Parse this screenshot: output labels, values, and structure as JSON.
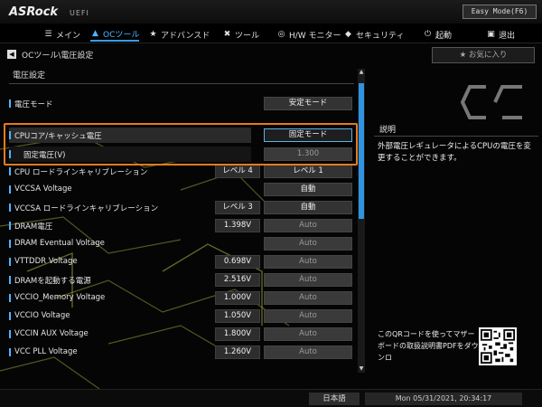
{
  "header": {
    "logo": "ASRock",
    "logo_sub": "UEFI",
    "easy_mode": "Easy Mode(F6)"
  },
  "nav": {
    "items": [
      {
        "label": "メイン",
        "icon": "menu-icon"
      },
      {
        "label": "OCツール",
        "icon": "rocket-icon"
      },
      {
        "label": "アドバンスド",
        "icon": "star-icon"
      },
      {
        "label": "ツール",
        "icon": "tools-icon"
      },
      {
        "label": "H/W モニター",
        "icon": "monitor-icon"
      },
      {
        "label": "セキュリティ",
        "icon": "shield-icon"
      },
      {
        "label": "起動",
        "icon": "power-icon"
      },
      {
        "label": "退出",
        "icon": "exit-icon"
      }
    ],
    "active": "OCツール"
  },
  "breadcrumb": "OCツール\\電圧設定",
  "favorite_label": "お気に入り",
  "section_title": "電圧設定",
  "rows": [
    {
      "label": "電圧モード",
      "value": "安定モード",
      "dim": false
    },
    {
      "label": "CPUコア/キャッシュ電圧",
      "value": "固定モード",
      "dim": false,
      "highlight": true
    },
    {
      "label": "固定電圧(V)",
      "value": "1.300",
      "dim": true,
      "subrow": true
    },
    {
      "label": "CPU ロードラインキャリブレーション",
      "sub": "レベル 4",
      "value": "レベル 1",
      "dim": false
    },
    {
      "label": "VCCSA Voltage",
      "value": "自動",
      "dim": false
    },
    {
      "label": "VCCSA ロードラインキャリブレーション",
      "sub": "レベル 3",
      "value": "自動",
      "dim": false
    },
    {
      "label": "DRAM電圧",
      "sub": "1.398V",
      "value": "Auto",
      "dim": true
    },
    {
      "label": "DRAM Eventual Voltage",
      "value": "Auto",
      "dim": true
    },
    {
      "label": "VTTDDR Voltage",
      "sub": "0.698V",
      "value": "Auto",
      "dim": true
    },
    {
      "label": "DRAMを起動する電源",
      "sub": "2.516V",
      "value": "Auto",
      "dim": true
    },
    {
      "label": "VCCIO_Memory Voltage",
      "sub": "1.000V",
      "value": "Auto",
      "dim": true
    },
    {
      "label": "VCCIO Voltage",
      "sub": "1.050V",
      "value": "Auto",
      "dim": true
    },
    {
      "label": "VCCIN AUX Voltage",
      "sub": "1.800V",
      "value": "Auto",
      "dim": true
    },
    {
      "label": "VCC PLL Voltage",
      "sub": "1.260V",
      "value": "Auto",
      "dim": true
    }
  ],
  "description": {
    "title": "説明",
    "text": "外部電圧レギュレータによるCPUの電圧を変更することができます。"
  },
  "qr_text": "このQRコードを使ってマザーボードの取扱説明書PDFをダウンロ",
  "footer": {
    "language": "日本語",
    "datetime": "Mon 05/31/2021, 20:34:17"
  },
  "colors": {
    "accent": "#2f93e0",
    "highlight_box": "#e57a1d"
  }
}
